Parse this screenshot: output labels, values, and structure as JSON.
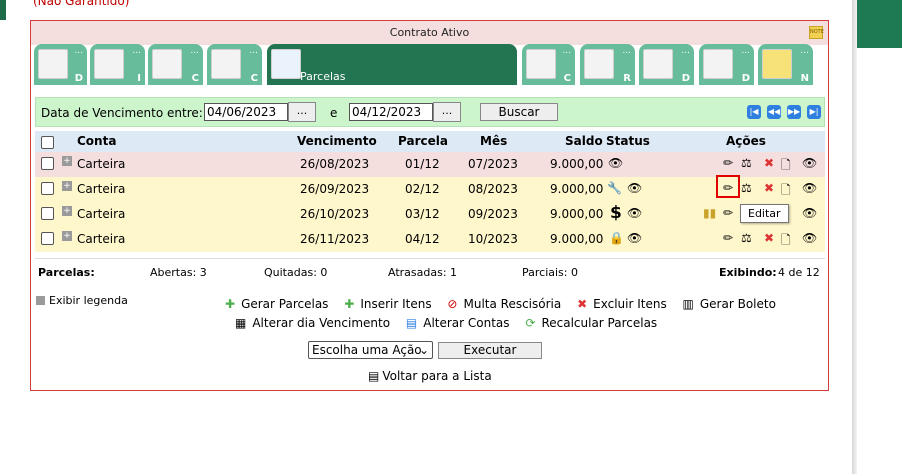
{
  "top_note": "(Não Garantido)",
  "panel": {
    "title": "Contrato Ativo"
  },
  "tabs": [
    {
      "icon": "contract-icon",
      "letter": "D"
    },
    {
      "icon": "person-icon",
      "letter": "I"
    },
    {
      "icon": "gears-icon",
      "letter": "C"
    },
    {
      "icon": "checklist-icon",
      "letter": "C"
    },
    {
      "icon": "folder-icon",
      "label": "Parcelas",
      "active": true
    },
    {
      "icon": "money-icon",
      "letter": "C"
    },
    {
      "icon": "transfer-icon",
      "letter": "R"
    },
    {
      "icon": "documents-icon",
      "letter": "D"
    },
    {
      "icon": "papers-icon",
      "letter": "D"
    },
    {
      "icon": "note-icon",
      "letter": "N"
    }
  ],
  "filter": {
    "label": "Data de Vencimento entre:",
    "from": "04/06/2023",
    "and_label": "e",
    "to": "04/12/2023",
    "dots_label": "...",
    "search_label": "Buscar"
  },
  "table": {
    "headers": {
      "conta": "Conta",
      "vencimento": "Vencimento",
      "parcela": "Parcela",
      "mes": "Mês",
      "saldo": "Saldo",
      "status": "Status",
      "acoes": "Ações"
    },
    "rows": [
      {
        "conta": "Carteira",
        "vencimento": "26/08/2023",
        "parcela": "01/12",
        "mes": "07/2023",
        "saldo": "9.000,00",
        "status": [
          "eye"
        ],
        "row_color": "pink"
      },
      {
        "conta": "Carteira",
        "vencimento": "26/09/2023",
        "parcela": "02/12",
        "mes": "08/2023",
        "saldo": "9.000,00",
        "status": [
          "wrench",
          "eye"
        ],
        "row_color": "yellow"
      },
      {
        "conta": "Carteira",
        "vencimento": "26/10/2023",
        "parcela": "03/12",
        "mes": "09/2023",
        "saldo": "9.000,00",
        "status": [
          "dollar",
          "eye"
        ],
        "row_color": "yellow"
      },
      {
        "conta": "Carteira",
        "vencimento": "26/11/2023",
        "parcela": "04/12",
        "mes": "10/2023",
        "saldo": "9.000,00",
        "status": [
          "lock",
          "eye"
        ],
        "row_color": "yellow"
      }
    ]
  },
  "summary": {
    "parcelas": "Parcelas:",
    "abertas": "Abertas: 3",
    "quitadas": "Quitadas: 0",
    "atrasadas": "Atrasadas: 1",
    "parciais": "Parciais: 0",
    "exibindo_label": "Exibindo:",
    "exibindo_value": "4 de 12"
  },
  "legend": "Exibir legenda",
  "actions": {
    "gerar_parcelas": "Gerar Parcelas",
    "inserir_itens": "Inserir Itens",
    "multa_rescisoria": "Multa Rescisória",
    "excluir_itens": "Excluir Itens",
    "gerar_boleto": "Gerar Boleto",
    "alterar_vencimento": "Alterar dia Vencimento",
    "alterar_contas": "Alterar Contas",
    "recalcular": "Recalcular Parcelas"
  },
  "select": {
    "value": "Escolha uma Ação",
    "button": "Executar"
  },
  "back": "Voltar para a Lista",
  "tooltip": "Editar"
}
